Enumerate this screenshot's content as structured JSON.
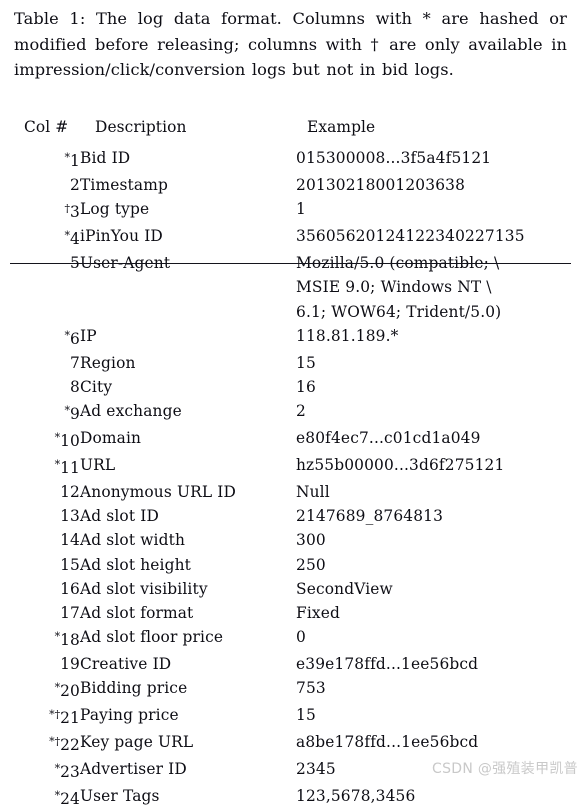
{
  "caption": {
    "text": "Table 1: The log data format. Columns with * are hashed or modified before releasing; columns with † are only available in impression/click/conversion logs but not in bid logs."
  },
  "table": {
    "headers": {
      "col_num": "Col #",
      "description": "Description",
      "example": "Example"
    },
    "rows": [
      {
        "marker": "*",
        "num": "1",
        "description": "Bid ID",
        "example": "015300008...3f5a4f5121"
      },
      {
        "marker": "",
        "num": "2",
        "description": "Timestamp",
        "example": "20130218001203638"
      },
      {
        "marker": "†",
        "num": "3",
        "description": "Log type",
        "example": "1"
      },
      {
        "marker": "*",
        "num": "4",
        "description": "iPinYou ID",
        "example": "35605620124122340227135"
      },
      {
        "marker": "",
        "num": "5",
        "description": "User-Agent",
        "example": "Mozilla/5.0 (compatible; \\",
        "example_lines": [
          "Mozilla/5.0 (compatible; \\",
          "MSIE 9.0; Windows NT \\",
          "6.1; WOW64; Trident/5.0)"
        ]
      },
      {
        "marker": "*",
        "num": "6",
        "description": "IP",
        "example": "118.81.189.*"
      },
      {
        "marker": "",
        "num": "7",
        "description": "Region",
        "example": "15"
      },
      {
        "marker": "",
        "num": "8",
        "description": "City",
        "example": "16"
      },
      {
        "marker": "*",
        "num": "9",
        "description": "Ad exchange",
        "example": "2"
      },
      {
        "marker": "*",
        "num": "10",
        "description": "Domain",
        "example": "e80f4ec7...c01cd1a049"
      },
      {
        "marker": "*",
        "num": "11",
        "description": "URL",
        "example": "hz55b00000...3d6f275121"
      },
      {
        "marker": "",
        "num": "12",
        "description": "Anonymous URL ID",
        "example": "Null"
      },
      {
        "marker": "",
        "num": "13",
        "description": "Ad slot ID",
        "example": "2147689_8764813"
      },
      {
        "marker": "",
        "num": "14",
        "description": "Ad slot width",
        "example": "300"
      },
      {
        "marker": "",
        "num": "15",
        "description": "Ad slot height",
        "example": "250"
      },
      {
        "marker": "",
        "num": "16",
        "description": "Ad slot visibility",
        "example": "SecondView"
      },
      {
        "marker": "",
        "num": "17",
        "description": "Ad slot format",
        "example": "Fixed"
      },
      {
        "marker": "*",
        "num": "18",
        "description": "Ad slot floor price",
        "example": "0"
      },
      {
        "marker": "",
        "num": "19",
        "description": "Creative ID",
        "example": "e39e178ffd...1ee56bcd"
      },
      {
        "marker": "*",
        "num": "20",
        "description": "Bidding price",
        "example": "753"
      },
      {
        "marker": "*†",
        "num": "21",
        "description": "Paying price",
        "example": "15"
      },
      {
        "marker": "*†",
        "num": "22",
        "description": "Key page URL",
        "example": "a8be178ffd...1ee56bcd"
      },
      {
        "marker": "*",
        "num": "23",
        "description": "Advertiser ID",
        "example": "2345"
      },
      {
        "marker": "*",
        "num": "24",
        "description": "User Tags",
        "example": "123,5678,3456"
      }
    ]
  },
  "watermark": {
    "text": "CSDN @强殖装甲凯普"
  },
  "colors": {
    "text": "#0d0d14",
    "rule": "#14141c",
    "watermark": "#c9c9c9",
    "background": "#ffffff"
  }
}
